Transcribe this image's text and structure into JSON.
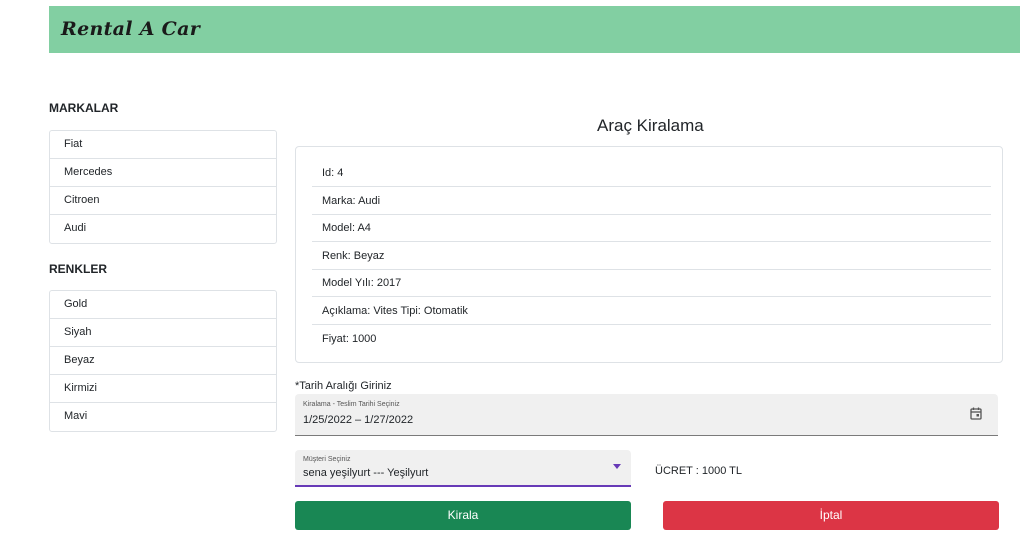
{
  "header": {
    "brand": "Rental A Car",
    "bg_color": "#82cfa2"
  },
  "sidebar": {
    "brands_title": "MARKALAR",
    "brands": [
      "Fiat",
      "Mercedes",
      "Citroen",
      "Audi"
    ],
    "colors_title": "RENKLER",
    "colors": [
      "Gold",
      "Siyah",
      "Beyaz",
      "Kirmizi",
      "Mavi"
    ]
  },
  "main": {
    "title": "Araç Kiralama",
    "details": [
      "Id: 4",
      "Marka: Audi",
      "Model: A4",
      "Renk: Beyaz",
      "Model Yılı: 2017",
      "Açıklama: Vites Tipi: Otomatik",
      "Fiyat: 1000"
    ]
  },
  "form": {
    "date_section_label": "*Tarih Aralığı Giriniz",
    "date_field_label": "Kiralama - Teslim Tarihi Seçiniz",
    "date_value": "1/25/2022 – 1/27/2022",
    "calendar_icon": "calendar-icon",
    "customer_field_label": "Müşteri Seçiniz",
    "customer_value": "sena yeşilyurt --- Yeşilyurt",
    "dropdown_icon": "dropdown-caret-icon",
    "accent_color": "#673ab7",
    "price_text": "ÜCRET : 1000 TL"
  },
  "actions": {
    "rent_label": "Kirala",
    "rent_color": "#198754",
    "cancel_label": "İptal",
    "cancel_color": "#dc3545"
  }
}
